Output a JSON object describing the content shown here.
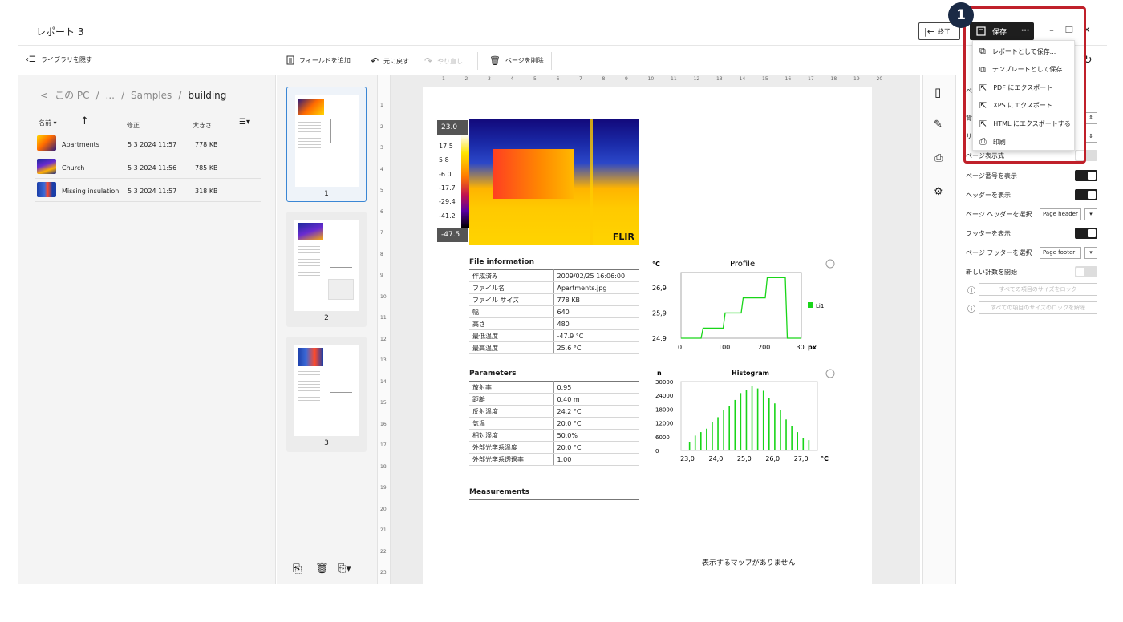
{
  "window": {
    "title": "レポート 3",
    "exit_label": "終了",
    "save_label": "保存",
    "more": "···",
    "minimize": "–",
    "restore": "❐",
    "close": "✕"
  },
  "toolbar": {
    "hide_library": "ライブラリを隠す",
    "add_field": "フィールドを追加",
    "undo": "元に戻す",
    "redo": "やり直し",
    "delete_page": "ページを削除"
  },
  "library": {
    "breadcrumb": {
      "back": "<",
      "root": "この PC",
      "sep": "/",
      "ellipsis": "...",
      "folder1": "Samples",
      "current": "building"
    },
    "columns": {
      "name": "名前",
      "modified": "修正",
      "size": "大きさ"
    },
    "files": [
      {
        "name": "Apartments",
        "modified": "5 3 2024 11:57",
        "size": "778 KB"
      },
      {
        "name": "Church",
        "modified": "5 3 2024 11:56",
        "size": "785 KB"
      },
      {
        "name": "Missing insulation",
        "modified": "5 3 2024 11:57",
        "size": "318 KB"
      }
    ]
  },
  "pages": [
    {
      "num": "1"
    },
    {
      "num": "2"
    },
    {
      "num": "3"
    }
  ],
  "ruler": {
    "h_ticks": [
      "1",
      "2",
      "3",
      "4",
      "5",
      "6",
      "7",
      "8",
      "9",
      "10",
      "11",
      "12",
      "13",
      "14",
      "15",
      "16",
      "17",
      "18",
      "19",
      "20"
    ],
    "v_ticks": [
      "1",
      "2",
      "3",
      "4",
      "5",
      "6",
      "7",
      "8",
      "9",
      "10",
      "11",
      "12",
      "13",
      "14",
      "15",
      "16",
      "17",
      "18",
      "19",
      "20",
      "21",
      "22",
      "23"
    ]
  },
  "report": {
    "thermal": {
      "max": "23.0",
      "min": "-47.5",
      "scale": [
        "17.5",
        "5.8",
        "-6.0",
        "-17.7",
        "-29.4",
        "-41.2"
      ],
      "unit": "°C",
      "brand": "FLIR"
    },
    "file_info": {
      "title": "File information",
      "rows": [
        [
          "作成済み",
          "2009/02/25 16:06:00"
        ],
        [
          "ファイル名",
          "Apartments.jpg"
        ],
        [
          "ファイル サイズ",
          "778 KB"
        ],
        [
          "幅",
          "640"
        ],
        [
          "高さ",
          "480"
        ],
        [
          "最低温度",
          "-47.9 °C"
        ],
        [
          "最高温度",
          "25.6 °C"
        ]
      ]
    },
    "parameters": {
      "title": "Parameters",
      "rows": [
        [
          "放射率",
          "0.95"
        ],
        [
          "距離",
          "0.40 m"
        ],
        [
          "反射温度",
          "24.2 °C"
        ],
        [
          "気温",
          "20.0 °C"
        ],
        [
          "相対湿度",
          "50.0%"
        ],
        [
          "外部光学系温度",
          "20.0 °C"
        ],
        [
          "外部光学系透過率",
          "1.00"
        ]
      ]
    },
    "measurements_title": "Measurements",
    "no_map": "表示するマップがありません"
  },
  "chart_data": [
    {
      "type": "line",
      "title": "Profile",
      "ylabel": "°C",
      "xlabel": "px",
      "yticks": [
        "26,9",
        "25,9",
        "24,9"
      ],
      "xticks": [
        "0",
        "100",
        "200",
        "30"
      ],
      "ylim": [
        24.9,
        27.5
      ],
      "xlim": [
        0,
        300
      ],
      "series": [
        {
          "name": "Li1",
          "color": "#19d519",
          "points": [
            [
              0,
              24.9
            ],
            [
              50,
              24.9
            ],
            [
              55,
              25.3
            ],
            [
              105,
              25.3
            ],
            [
              110,
              25.9
            ],
            [
              150,
              25.9
            ],
            [
              155,
              26.5
            ],
            [
              210,
              26.5
            ],
            [
              215,
              27.3
            ],
            [
              260,
              27.3
            ],
            [
              265,
              24.9
            ],
            [
              300,
              24.9
            ]
          ]
        }
      ]
    },
    {
      "type": "bar",
      "title": "Histogram",
      "ylabel": "n",
      "yticks": [
        "30000",
        "24000",
        "18000",
        "12000",
        "6000",
        "0"
      ],
      "xticks": [
        "23,0",
        "24,0",
        "25,0",
        "26,0",
        "27,0"
      ],
      "xlabel": "°C",
      "ylim": [
        0,
        30000
      ],
      "color": "#19d519",
      "bars": [
        [
          23.1,
          3500
        ],
        [
          23.3,
          6500
        ],
        [
          23.5,
          8000
        ],
        [
          23.7,
          9500
        ],
        [
          23.9,
          12500
        ],
        [
          24.1,
          14500
        ],
        [
          24.3,
          17500
        ],
        [
          24.5,
          19500
        ],
        [
          24.7,
          22000
        ],
        [
          24.9,
          25000
        ],
        [
          25.1,
          26500
        ],
        [
          25.3,
          28000
        ],
        [
          25.5,
          27000
        ],
        [
          25.7,
          26000
        ],
        [
          25.9,
          23000
        ],
        [
          26.1,
          20500
        ],
        [
          26.3,
          17500
        ],
        [
          26.5,
          13500
        ],
        [
          26.7,
          10500
        ],
        [
          26.9,
          8000
        ],
        [
          27.1,
          5500
        ],
        [
          27.3,
          4500
        ]
      ]
    }
  ],
  "properties": {
    "rows": [
      {
        "label": "ページ番号を表示",
        "type": "toggle",
        "on": true
      },
      {
        "label": "ヘッダーを表示",
        "type": "toggle",
        "on": true
      },
      {
        "label": "ページ ヘッダーを選択",
        "type": "select",
        "value": "Page header"
      },
      {
        "label": "フッターを表示",
        "type": "toggle",
        "on": true
      },
      {
        "label": "ページ フッターを選択",
        "type": "select",
        "value": "Page footer"
      },
      {
        "label": "新しい計数を開始",
        "type": "toggle",
        "on": false
      }
    ],
    "page_format": "ページ表示式",
    "lock_all": "すべての項目のサイズをロック",
    "unlock_all": "すべての項目のサイズのロックを解除",
    "partial_1": "ペ",
    "partial_2": "背",
    "partial_3": "サ"
  },
  "save_menu": {
    "items": [
      {
        "label": "レポートとして保存...",
        "icon": "copy-icon"
      },
      {
        "label": "テンプレートとして保存...",
        "icon": "copy-icon"
      },
      {
        "label": "PDF にエクスポート",
        "icon": "export-icon"
      },
      {
        "label": "XPS にエクスポート",
        "icon": "export-icon"
      },
      {
        "label": "HTML にエクスポートする",
        "icon": "export-icon"
      },
      {
        "label": "印刷",
        "icon": "print-icon"
      }
    ]
  },
  "annotation": {
    "badge": "1",
    "color": "#c0202a"
  }
}
